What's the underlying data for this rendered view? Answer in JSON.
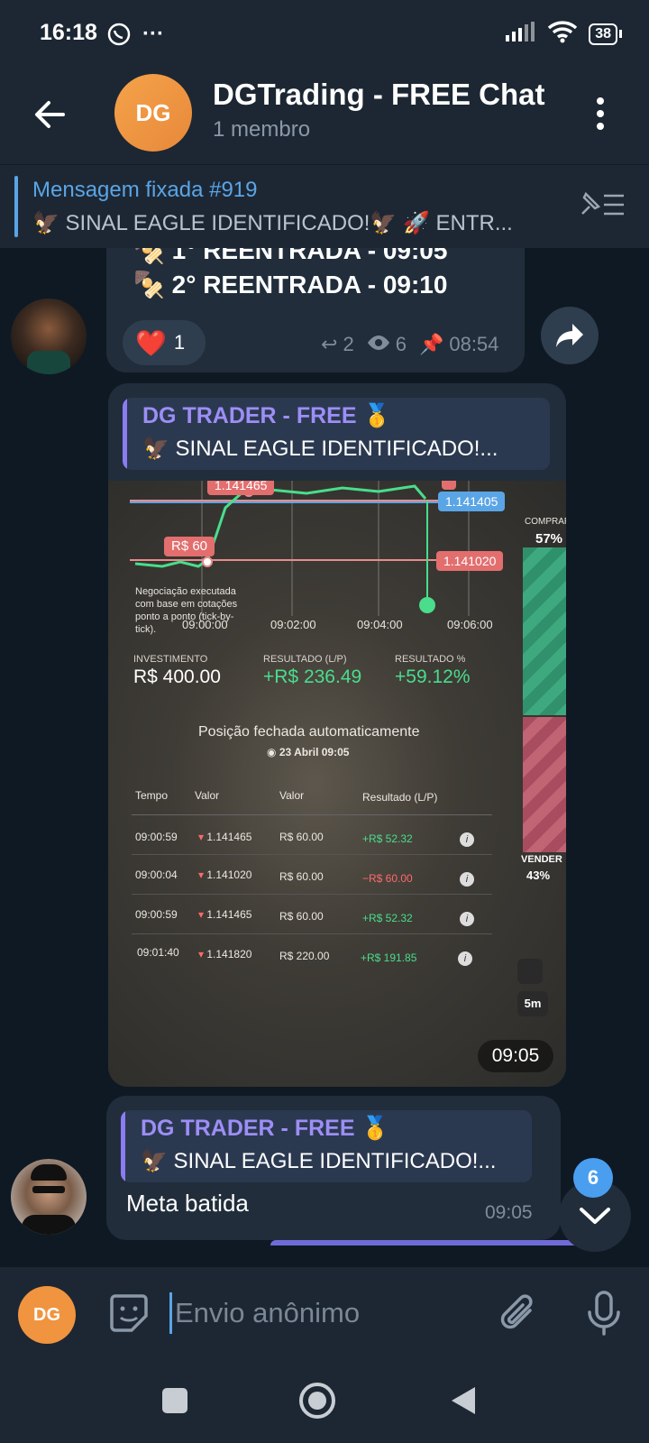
{
  "status_bar": {
    "time": "16:18",
    "battery": "38"
  },
  "header": {
    "avatar_initials": "DG",
    "title": "DGTrading - FREE Chat",
    "subtitle": "1 membro"
  },
  "pinned": {
    "title": "Mensagem fixada #919",
    "text": "🦅 SINAL EAGLE IDENTIFICADO!🦅 🚀 ENTR..."
  },
  "msg1": {
    "lines": [
      "1° REENTRADA -  09:05",
      "2° REENTRADA - 09:10"
    ],
    "reaction_emoji": "❤️",
    "reaction_count": "1",
    "replies": "2",
    "views": "6",
    "time": "08:54"
  },
  "msg2": {
    "quote_name": "DG TRADER - FREE 🥇",
    "quote_text": "🦅 SINAL EAGLE IDENTIFICADO!...",
    "time": "09:05",
    "screenshot": {
      "price_top": "1.141465",
      "price_blue": "1.141405",
      "price_mid": "1.141020",
      "trade_tag": "R$ 60",
      "note": "Negociação executada com base em cotações ponto a ponto (tick-by-tick).",
      "x_ticks": [
        "09:00:00",
        "09:02:00",
        "09:04:00",
        "09:06:00"
      ],
      "side_buy": "COMPRAR",
      "side_buy_pct": "57%",
      "side_sell": "VENDER",
      "side_sell_pct": "43%",
      "invest_label": "INVESTIMENTO",
      "invest_value": "R$ 400.00",
      "result_label": "RESULTADO (L/P)",
      "result_value": "+R$ 236.49",
      "result_pct_label": "RESULTADO %",
      "result_pct_value": "+59.12%",
      "closed_text": "Posição fechada automaticamente",
      "closed_date": "23 Abril 09:05",
      "table_headers": [
        "Tempo",
        "Valor",
        "Valor",
        "Resultado (L/P)"
      ],
      "rows": [
        {
          "time": "09:00:59",
          "price": "1.141465",
          "amount": "R$ 60.00",
          "result": "+R$ 52.32",
          "positive": true
        },
        {
          "time": "09:00:04",
          "price": "1.141020",
          "amount": "R$ 60.00",
          "result": "−R$ 60.00",
          "positive": false
        },
        {
          "time": "09:00:59",
          "price": "1.141465",
          "amount": "R$ 60.00",
          "result": "+R$ 52.32",
          "positive": true
        },
        {
          "time": "09:01:40",
          "price": "1.141820",
          "amount": "R$ 220.00",
          "result": "+R$ 191.85",
          "positive": true
        }
      ],
      "timeframe": "5m"
    }
  },
  "msg3": {
    "quote_name": "DG TRADER - FREE 🥇",
    "quote_text": "🦅 SINAL EAGLE IDENTIFICADO!...",
    "text": "Meta batida",
    "time": "09:05"
  },
  "unread_badge": "6",
  "input": {
    "avatar_initials": "DG",
    "placeholder": "Envio anônimo"
  },
  "colors": {
    "accent": "#5aa5e6",
    "bubble": "#212d3b",
    "quote": "#9d8ef6",
    "profit": "#49dd8c",
    "loss": "#ff6a6a"
  }
}
